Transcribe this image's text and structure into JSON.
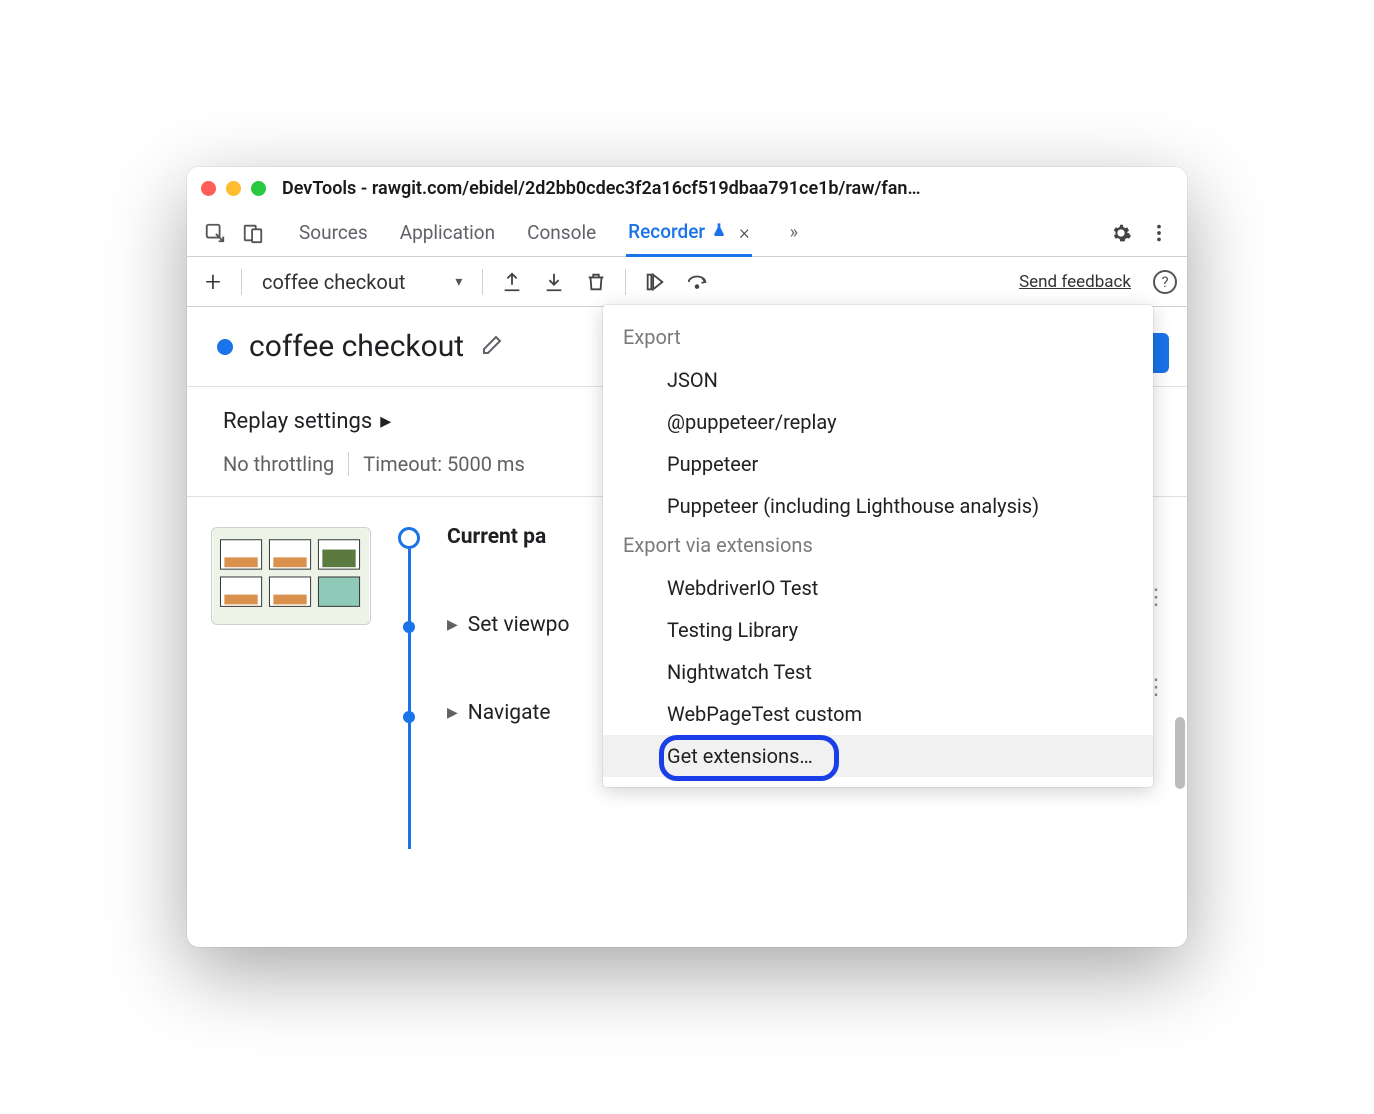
{
  "window": {
    "title": "DevTools - rawgit.com/ebidel/2d2bb0cdec3f2a16cf519dbaa791ce1b/raw/fan…"
  },
  "tabs": {
    "sources": "Sources",
    "application": "Application",
    "console": "Console",
    "recorder": "Recorder"
  },
  "toolbar": {
    "recording_name": "coffee checkout",
    "send_feedback": "Send feedback"
  },
  "header": {
    "title": "coffee checkout"
  },
  "settings": {
    "title": "Replay settings",
    "throttling": "No throttling",
    "timeout": "Timeout: 5000 ms"
  },
  "steps": {
    "current": "Current pa",
    "set_viewport": "Set viewpo",
    "navigate": "Navigate"
  },
  "dropdown": {
    "section1": "Export",
    "items1": {
      "json": "JSON",
      "replay": "@puppeteer/replay",
      "puppeteer": "Puppeteer",
      "lighthouse": "Puppeteer (including Lighthouse analysis)"
    },
    "section2": "Export via extensions",
    "items2": {
      "webdriverio": "WebdriverIO Test",
      "testinglib": "Testing Library",
      "nightwatch": "Nightwatch Test",
      "webpagetest": "WebPageTest custom",
      "getext": "Get extensions…"
    }
  }
}
